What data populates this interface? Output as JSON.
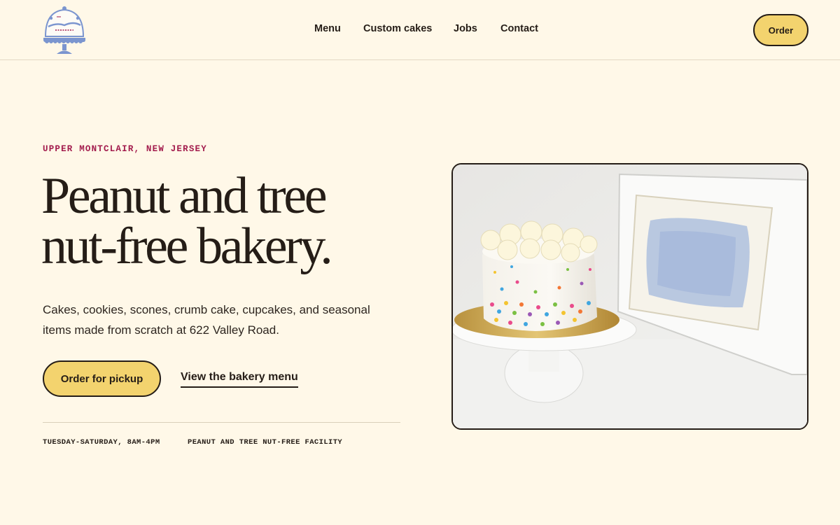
{
  "header": {
    "logo_alt": "The Little Daisy Bake Shop",
    "nav": [
      {
        "label": "Menu"
      },
      {
        "label": "Custom cakes"
      },
      {
        "label": "Jobs"
      },
      {
        "label": "Contact"
      }
    ],
    "order_label": "Order"
  },
  "hero": {
    "eyebrow": "UPPER MONTCLAIR, NEW JERSEY",
    "headline_line1": "Peanut and tree",
    "headline_line2": "nut-free bakery.",
    "subtext": "Cakes, cookies, scones, crumb cake, cupcakes, and seasonal items made from scratch at 622 Valley Road.",
    "primary_cta": "Order for pickup",
    "secondary_cta": "View the bakery menu",
    "hours": "TUESDAY-SATURDAY, 8AM-4PM",
    "facility": "PEANUT AND TREE NUT-FREE FACILITY",
    "image_description": "White frosted cake with rainbow sprinkles on a white cake stand beside a framed blue watercolor"
  },
  "colors": {
    "background": "#fff8e8",
    "accent_yellow": "#f3d36e",
    "eyebrow_red": "#a31c4d",
    "ink": "#251d17",
    "logo_blue": "#7b95cf"
  }
}
